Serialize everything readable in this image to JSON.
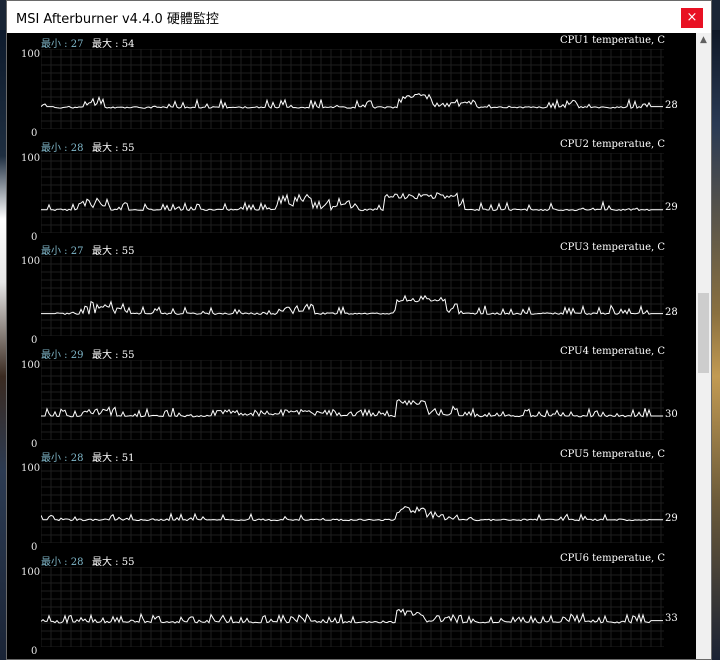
{
  "window": {
    "title": "MSI Afterburner v4.4.0 硬體監控",
    "close_glyph": "×"
  },
  "scrollbar": {
    "up_glyph": "▲"
  },
  "graph": {
    "y_max": "100",
    "y_min": "0",
    "grid_color": "#1e1e1e",
    "line_color": "#ffffff"
  },
  "panels": [
    {
      "name": "CPU1 temperatue, C",
      "min_label": "最小 : 27",
      "max_label": "最大 : 54",
      "current": "28",
      "series": {
        "baseline": 27,
        "start": 28,
        "end": 28,
        "plateau": [
          0.58,
          0.63,
          40
        ],
        "bursts": [
          [
            0.07,
            0.1,
            15
          ],
          [
            0.38,
            0.4,
            10
          ],
          [
            0.62,
            0.7,
            10
          ]
        ],
        "noise": 5,
        "spike_rate": 0.22,
        "seed": 11
      }
    },
    {
      "name": "CPU2 temperatue, C",
      "min_label": "最小 : 28",
      "max_label": "最大 : 55",
      "current": "29",
      "series": {
        "baseline": 29,
        "start": 29,
        "end": 29,
        "plateau": [
          0.55,
          0.67,
          45
        ],
        "bursts": [
          [
            0.06,
            0.11,
            15
          ],
          [
            0.38,
            0.45,
            20
          ],
          [
            0.45,
            0.51,
            15
          ],
          [
            0.55,
            0.68,
            15
          ]
        ],
        "noise": 5,
        "spike_rate": 0.2,
        "seed": 23
      }
    },
    {
      "name": "CPU3 temperatue, C",
      "min_label": "最小 : 27",
      "max_label": "最大 : 55",
      "current": "28",
      "series": {
        "baseline": 28,
        "start": 28,
        "end": 28,
        "plateau": [
          0.57,
          0.65,
          45
        ],
        "bursts": [
          [
            0.08,
            0.14,
            15
          ],
          [
            0.38,
            0.44,
            12
          ],
          [
            0.57,
            0.67,
            15
          ]
        ],
        "noise": 5,
        "spike_rate": 0.2,
        "seed": 37
      }
    },
    {
      "name": "CPU4 temperatue, C",
      "min_label": "最小 : 29",
      "max_label": "最大 : 55",
      "current": "30",
      "series": {
        "baseline": 30,
        "start": 30,
        "end": 30,
        "plateau": [
          0.57,
          0.62,
          45
        ],
        "bursts": [
          [
            0.07,
            0.12,
            12
          ],
          [
            0.28,
            0.55,
            8
          ],
          [
            0.62,
            0.67,
            12
          ]
        ],
        "noise": 5,
        "spike_rate": 0.35,
        "seed": 41
      }
    },
    {
      "name": "CPU5 temperatue, C",
      "min_label": "最小 : 28",
      "max_label": "最大 : 51",
      "current": "29",
      "series": {
        "baseline": 29,
        "start": 29,
        "end": 29,
        "plateau": [
          0.57,
          0.62,
          40
        ],
        "bursts": [
          [
            0.62,
            0.67,
            10
          ]
        ],
        "noise": 4,
        "spike_rate": 0.18,
        "seed": 53
      }
    },
    {
      "name": "CPU6 temperatue, C",
      "min_label": "最小 : 28",
      "max_label": "最大 : 55",
      "current": "33",
      "series": {
        "baseline": 31,
        "start": 32,
        "end": 33,
        "plateau": [
          0.57,
          0.61,
          42
        ],
        "bursts": [
          [
            0.4,
            0.44,
            10
          ],
          [
            0.61,
            0.66,
            10
          ]
        ],
        "noise": 5,
        "spike_rate": 0.4,
        "seed": 67
      }
    }
  ]
}
